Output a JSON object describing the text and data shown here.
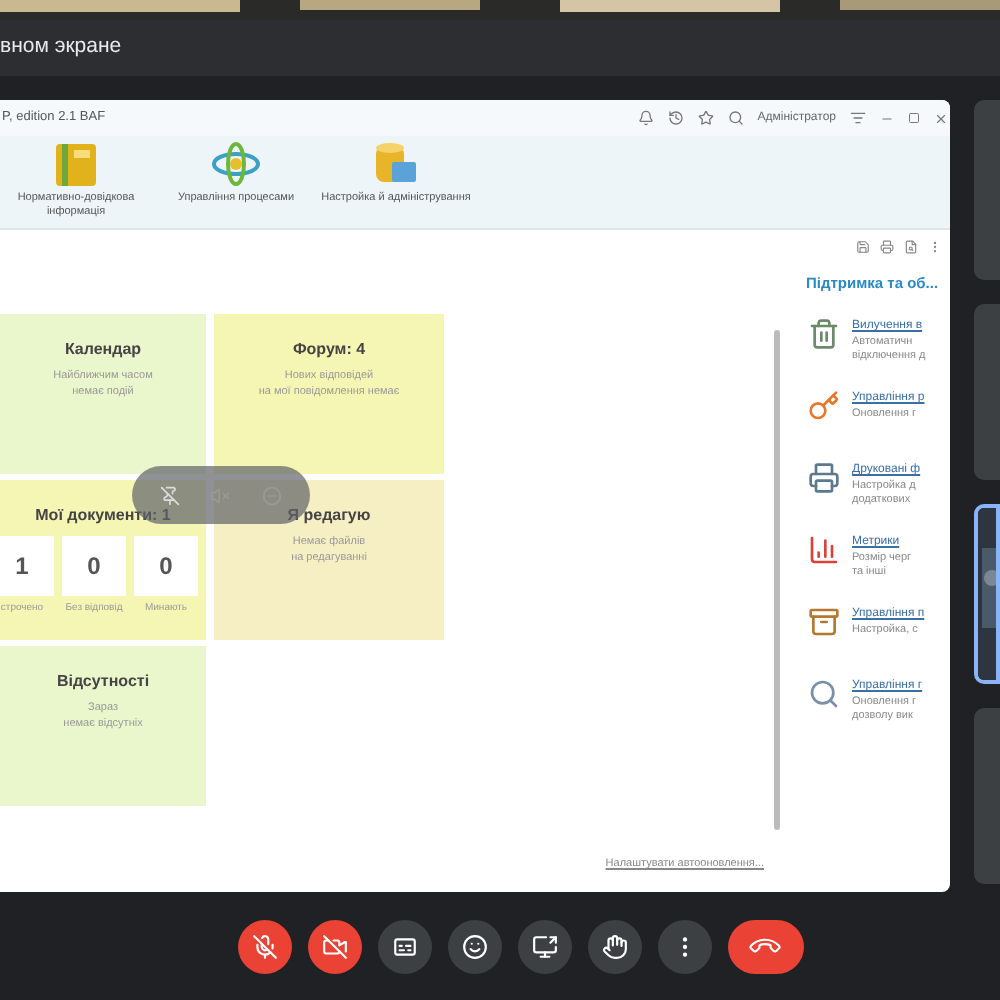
{
  "meet": {
    "banner": "вном экране"
  },
  "app": {
    "title": "P, edition 2.1 BAF",
    "user": "Адміністратор",
    "sections": [
      {
        "label": "Нормативно-довідкова інформація",
        "kind": "folder"
      },
      {
        "label": "Управління процесами",
        "kind": "process"
      },
      {
        "label": "Настройка й адміністрування",
        "kind": "database"
      }
    ],
    "tiles": [
      {
        "kind": "text",
        "title": "Календар",
        "lines": [
          "Найближчим часом",
          "немає подій"
        ],
        "color": "#eaf6cc"
      },
      {
        "kind": "text",
        "title": "Форум: 4",
        "lines": [
          "Нових відповідей",
          "на мої повідомлення немає"
        ],
        "color": "#f6f6b4"
      },
      {
        "kind": "counters",
        "title": "Мої документи: 1",
        "counters": [
          {
            "value": "1",
            "label": "строчено"
          },
          {
            "value": "0",
            "label": "Без відповід"
          },
          {
            "value": "0",
            "label": "Минають"
          }
        ],
        "color": "#f6f6b4"
      },
      {
        "kind": "text",
        "title": "Я редагую",
        "lines": [
          "Немає файлів",
          "на редагуванні"
        ],
        "color": "#f7efc4"
      },
      {
        "kind": "text",
        "title": "Відсутності",
        "lines": [
          "Зараз",
          "немає відсутніх"
        ],
        "color": "#eaf6cc"
      }
    ],
    "autorefresh_link": "Налаштувати автооновлення...",
    "support": {
      "title": "Підтримка та об...",
      "items": [
        {
          "kind": "trash",
          "link": "Вилучення в",
          "lines": [
            "Автоматичн",
            "відключення д"
          ]
        },
        {
          "kind": "key",
          "link": "Управління р",
          "lines": [
            "Оновлення г"
          ]
        },
        {
          "kind": "printer",
          "link": "Друковані ф",
          "lines": [
            "Настройка д",
            "додаткових"
          ]
        },
        {
          "kind": "chart",
          "link": "Метрики",
          "lines": [
            "Розмір черг",
            "та інші"
          ]
        },
        {
          "kind": "cabinet",
          "link": "Управління п",
          "lines": [
            "Настройка, с"
          ]
        },
        {
          "kind": "search",
          "link": "Управління г",
          "lines": [
            "Оновлення г",
            "дозволу вик"
          ]
        }
      ]
    }
  },
  "controls": [
    {
      "kind": "mic",
      "on": false
    },
    {
      "kind": "camera",
      "on": false
    },
    {
      "kind": "captions"
    },
    {
      "kind": "emoji"
    },
    {
      "kind": "present"
    },
    {
      "kind": "hand"
    },
    {
      "kind": "more"
    },
    {
      "kind": "leave"
    }
  ]
}
